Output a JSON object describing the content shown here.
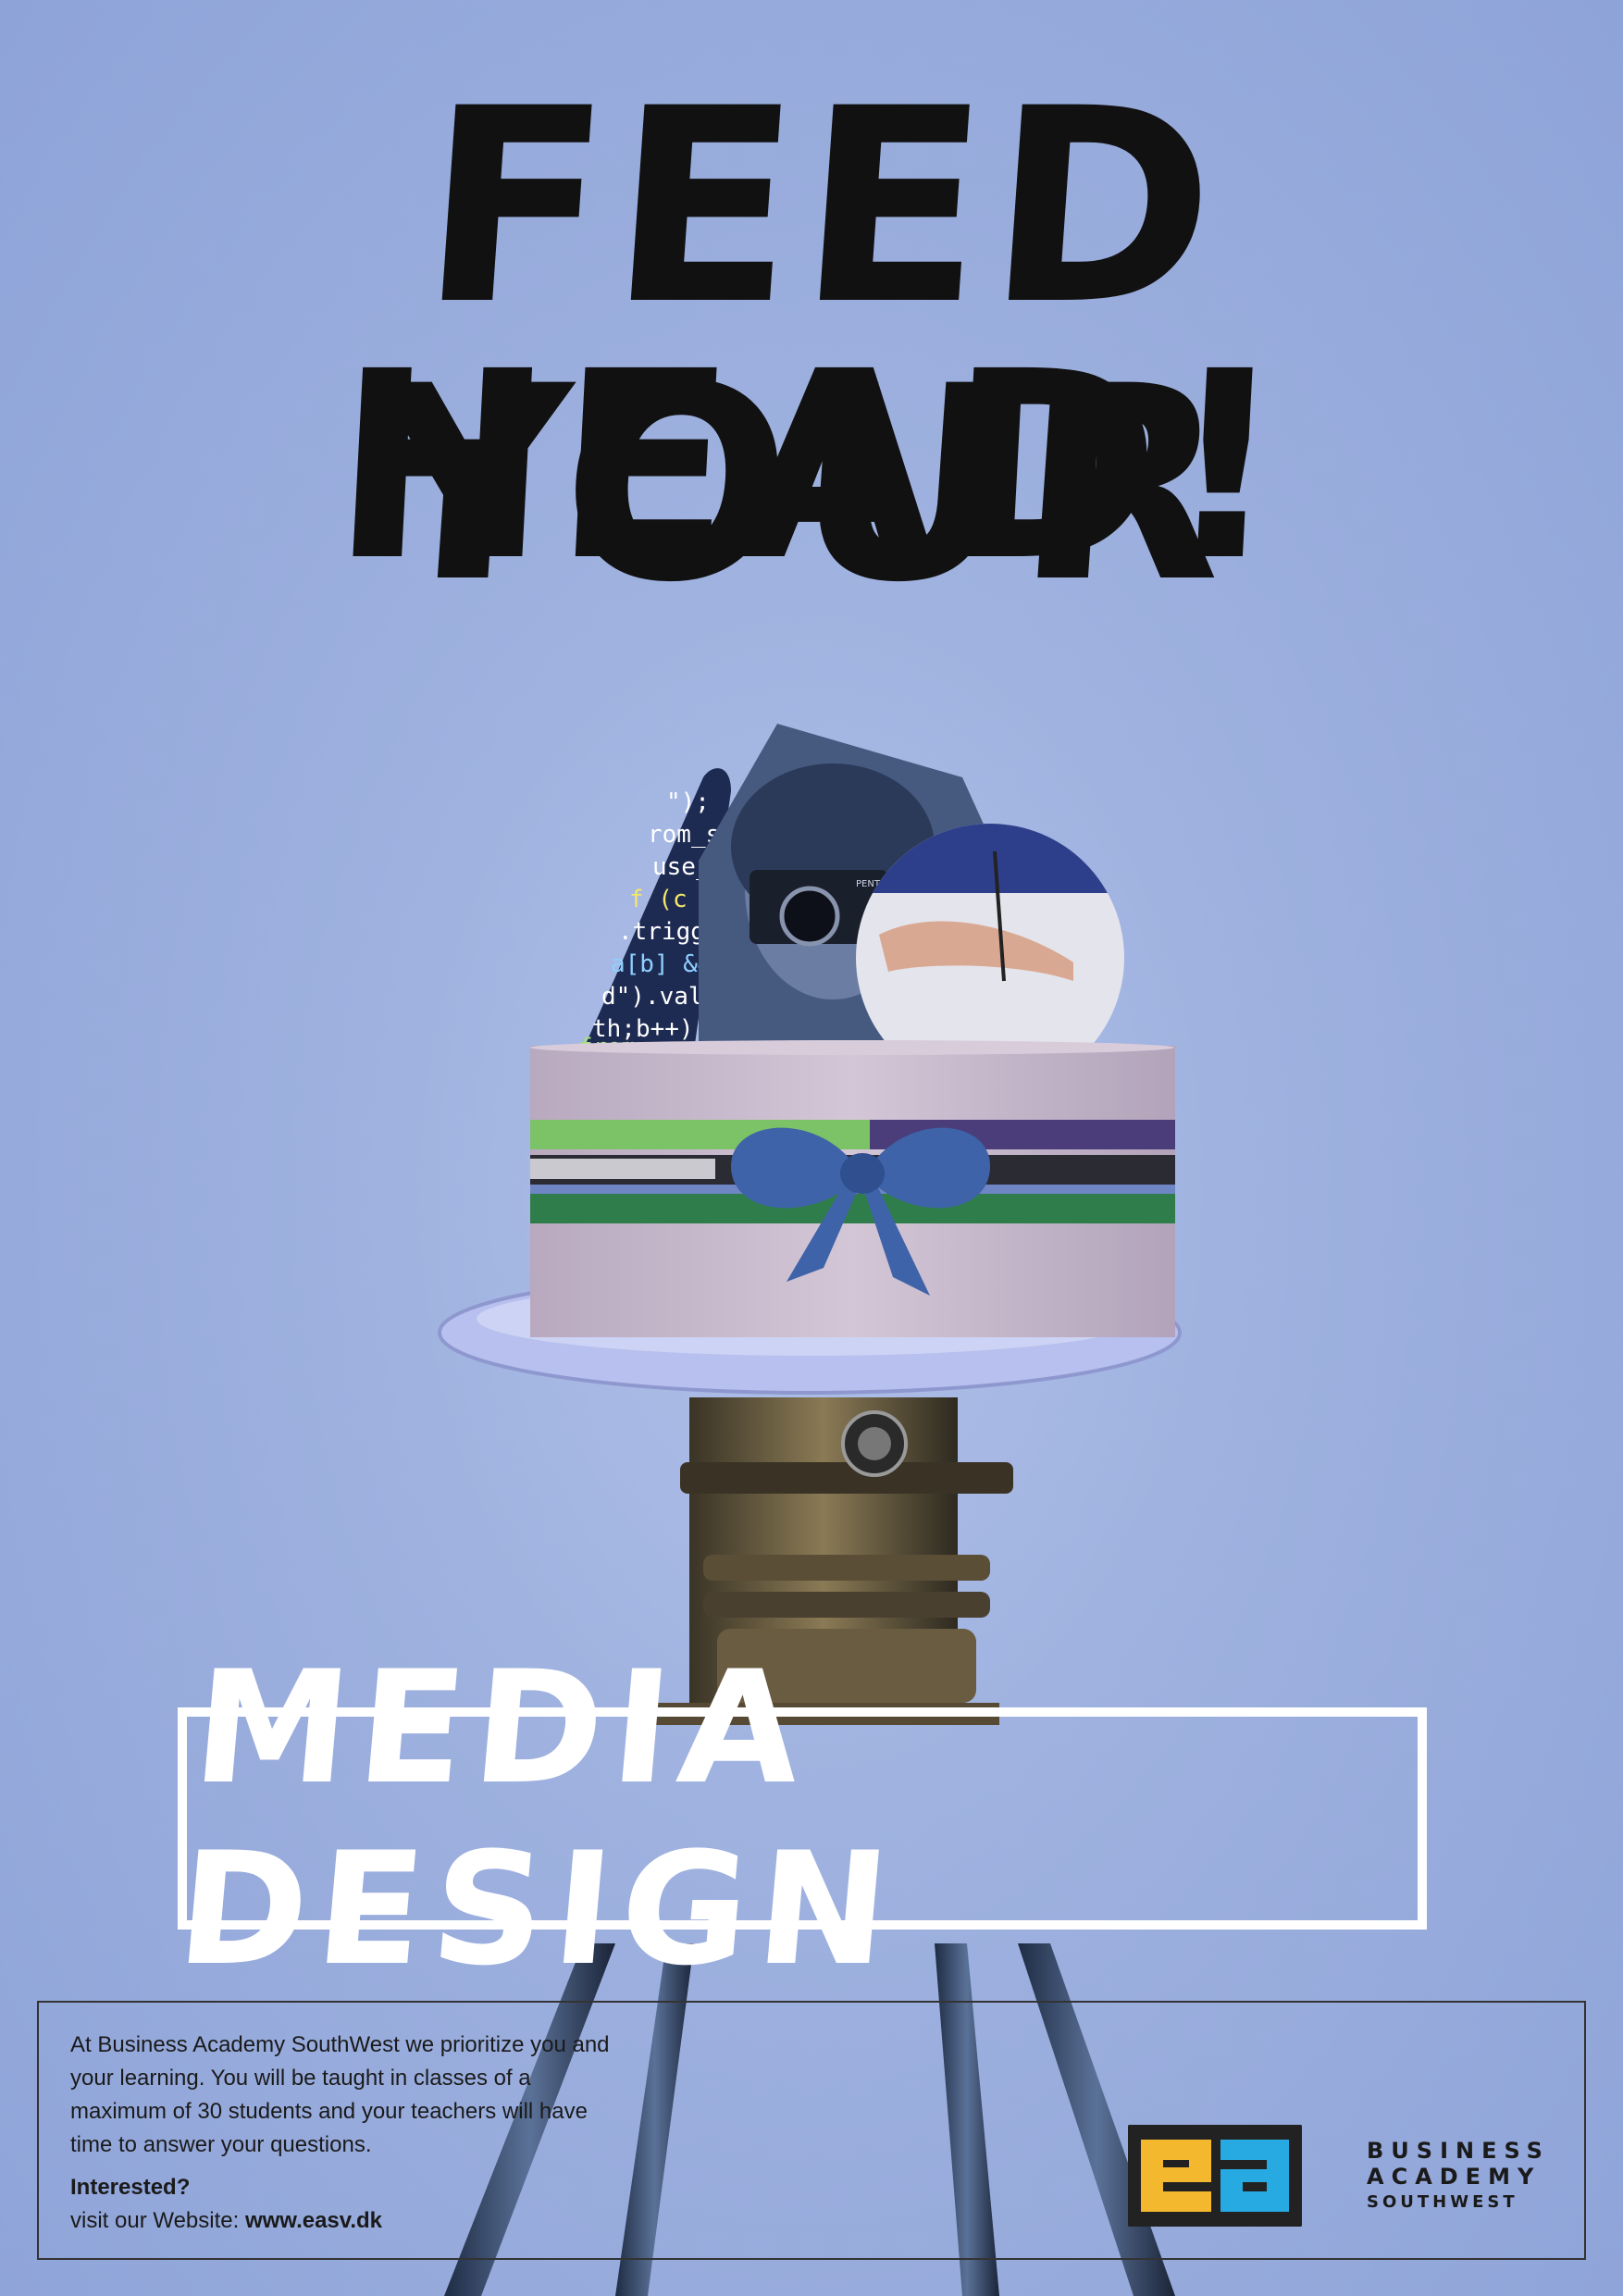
{
  "poster": {
    "headline_line1": "FEED YOUR",
    "headline_line2": "HEAD!",
    "program_title": "MEDIA DESIGN",
    "code_snippet": [
      "\");",
      "rom_s",
      "use_",
      "f (c <",
      ".trigge",
      "a[b] &&",
      "d\").val(",
      "th;b++) {",
      "from"
    ],
    "camera_brand": "PENTAX"
  },
  "info": {
    "body_line1": "At Business Academy SouthWest we prioritize you and",
    "body_line2": "your learning. You will be taught in classes of a",
    "body_line3": "maximum of 30 students and your teachers will have",
    "body_line4": "time to answer your questions.",
    "cta_heading": "Interested?",
    "website_prefix": "visit our Website: ",
    "website_url": "www.easv.dk"
  },
  "logo": {
    "mark_letters": "ea",
    "brand_line1": "BUSINESS",
    "brand_line2": "ACADEMY",
    "brand_line3": "SOUTHWEST"
  },
  "colors": {
    "background": "#9eb1df",
    "logo_yellow": "#f4b82e",
    "logo_blue": "#27a9e1",
    "headline": "#111111",
    "box_white": "#ffffff"
  }
}
